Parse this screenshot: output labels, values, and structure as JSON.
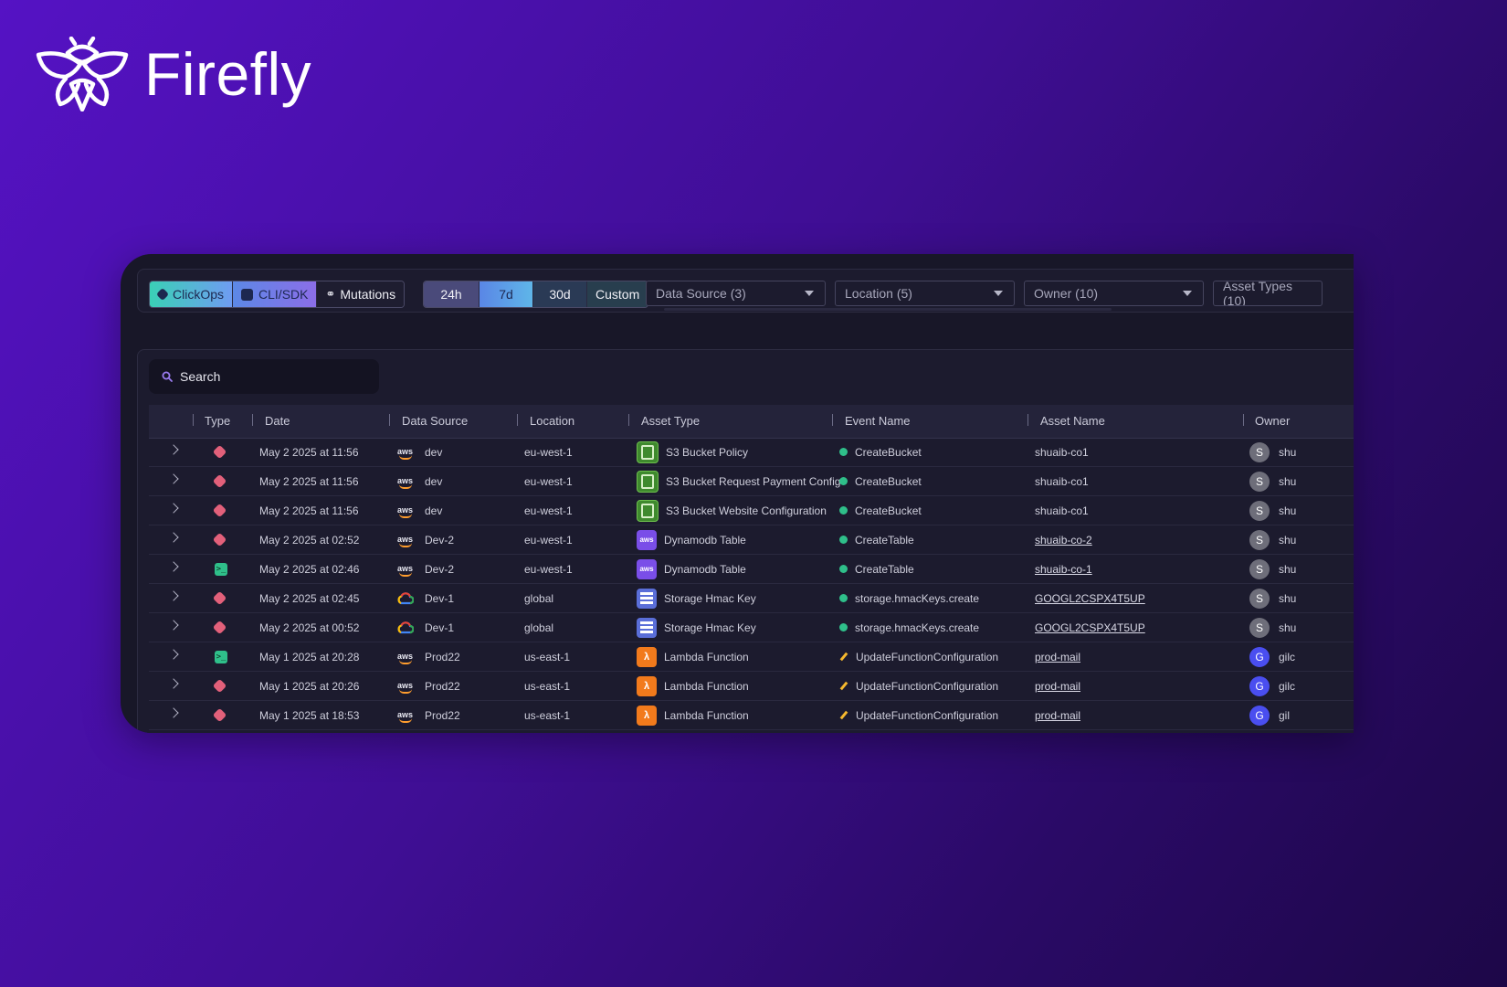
{
  "brand": {
    "name": "Firefly"
  },
  "filters": {
    "type_segments": [
      {
        "label": "ClickOps",
        "icon": "clickops-icon"
      },
      {
        "label": "CLI/SDK",
        "icon": "terminal-icon"
      },
      {
        "label": "Mutations",
        "icon": "mutations-icon"
      }
    ],
    "time_segments": [
      "24h",
      "7d",
      "30d",
      "Custom"
    ],
    "dropdowns": [
      "Data Source (3)",
      "Location (5)",
      "Owner (10)",
      "Asset Types (10)"
    ]
  },
  "search": {
    "placeholder": "Search"
  },
  "table": {
    "columns": [
      "Type",
      "Date",
      "Data Source",
      "Location",
      "Asset Type",
      "Event Name",
      "Asset Name",
      "Owner"
    ],
    "rows": [
      {
        "type": "clickops",
        "date": "May 2 2025 at 11:56",
        "provider": "aws",
        "data_source": "dev",
        "location": "eu-west-1",
        "asset_icon": "s3",
        "asset_type": "S3 Bucket Policy",
        "event_kind": "create",
        "event_name": "CreateBucket",
        "asset_name": "shuaib-co1",
        "asset_link": false,
        "owner_initial": "S",
        "owner": "shu"
      },
      {
        "type": "clickops",
        "date": "May 2 2025 at 11:56",
        "provider": "aws",
        "data_source": "dev",
        "location": "eu-west-1",
        "asset_icon": "s3",
        "asset_type": "S3 Bucket Request Payment Config",
        "event_kind": "create",
        "event_name": "CreateBucket",
        "asset_name": "shuaib-co1",
        "asset_link": false,
        "owner_initial": "S",
        "owner": "shu"
      },
      {
        "type": "clickops",
        "date": "May 2 2025 at 11:56",
        "provider": "aws",
        "data_source": "dev",
        "location": "eu-west-1",
        "asset_icon": "s3",
        "asset_type": "S3 Bucket Website Configuration",
        "event_kind": "create",
        "event_name": "CreateBucket",
        "asset_name": "shuaib-co1",
        "asset_link": false,
        "owner_initial": "S",
        "owner": "shu"
      },
      {
        "type": "clickops",
        "date": "May 2 2025 at 02:52",
        "provider": "aws",
        "data_source": "Dev-2",
        "location": "eu-west-1",
        "asset_icon": "dynamodb",
        "asset_type": "Dynamodb Table",
        "event_kind": "create",
        "event_name": "CreateTable",
        "asset_name": "shuaib-co-2",
        "asset_link": true,
        "owner_initial": "S",
        "owner": "shu"
      },
      {
        "type": "cli",
        "date": "May 2 2025 at 02:46",
        "provider": "aws",
        "data_source": "Dev-2",
        "location": "eu-west-1",
        "asset_icon": "dynamodb",
        "asset_type": "Dynamodb Table",
        "event_kind": "create",
        "event_name": "CreateTable",
        "asset_name": "shuaib-co-1",
        "asset_link": true,
        "owner_initial": "S",
        "owner": "shu"
      },
      {
        "type": "clickops",
        "date": "May 2 2025 at 02:45",
        "provider": "gcp",
        "data_source": "Dev-1",
        "location": "global",
        "asset_icon": "hmac",
        "asset_type": "Storage Hmac Key",
        "event_kind": "create",
        "event_name": "storage.hmacKeys.create",
        "asset_name": "GOOGL2CSPX4T5UP",
        "asset_link": true,
        "owner_initial": "S",
        "owner": "shu"
      },
      {
        "type": "clickops",
        "date": "May 2 2025 at 00:52",
        "provider": "gcp",
        "data_source": "Dev-1",
        "location": "global",
        "asset_icon": "hmac",
        "asset_type": "Storage Hmac Key",
        "event_kind": "create",
        "event_name": "storage.hmacKeys.create",
        "asset_name": "GOOGL2CSPX4T5UP",
        "asset_link": true,
        "owner_initial": "S",
        "owner": "shu"
      },
      {
        "type": "cli",
        "date": "May 1 2025 at 20:28",
        "provider": "aws",
        "data_source": "Prod22",
        "location": "us-east-1",
        "asset_icon": "lambda",
        "asset_type": "Lambda Function",
        "event_kind": "update",
        "event_name": "UpdateFunctionConfiguration",
        "asset_name": "prod-mail",
        "asset_link": true,
        "owner_initial": "G",
        "owner": "gilc"
      },
      {
        "type": "clickops",
        "date": "May 1 2025 at 20:26",
        "provider": "aws",
        "data_source": "Prod22",
        "location": "us-east-1",
        "asset_icon": "lambda",
        "asset_type": "Lambda Function",
        "event_kind": "update",
        "event_name": "UpdateFunctionConfiguration",
        "asset_name": "prod-mail",
        "asset_link": true,
        "owner_initial": "G",
        "owner": "gilc"
      },
      {
        "type": "clickops",
        "date": "May 1 2025 at 18:53",
        "provider": "aws",
        "data_source": "Prod22",
        "location": "us-east-1",
        "asset_icon": "lambda",
        "asset_type": "Lambda Function",
        "event_kind": "update",
        "event_name": "UpdateFunctionConfiguration",
        "asset_name": "prod-mail",
        "asset_link": true,
        "owner_initial": "G",
        "owner": "gil"
      }
    ]
  }
}
